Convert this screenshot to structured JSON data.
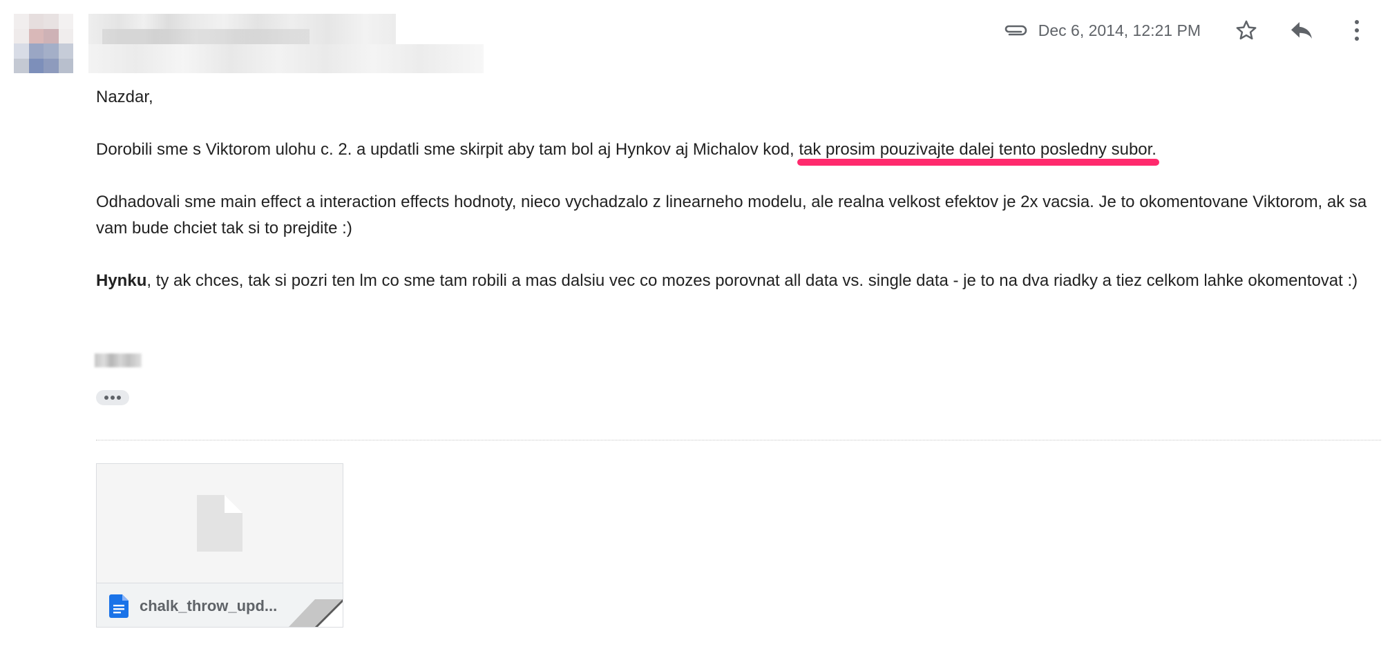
{
  "header": {
    "date": "Dec 6, 2014, 12:21 PM",
    "icons": [
      "attachment-icon",
      "star-icon",
      "reply-icon",
      "more-vert-icon"
    ]
  },
  "body": {
    "greeting": "Nazdar,",
    "p1_plain": "Dorobili sme s Viktorom ulohu c. 2. a updatli sme skirpit aby tam bol aj Hynkov aj Michalov kod, ",
    "p1_highlight": "tak prosim pouzivajte dalej tento posledny subor.",
    "p2": "Odhadovali sme main effect a interaction effects hodnoty, nieco vychadzalo z linearneho modelu, ale realna velkost efektov je 2x vacsia. Je to okomentovane Viktorom, ak sa vam bude chciet tak si to prejdite :)",
    "p3_bold": "Hynku",
    "p3_rest": ", ty ak chces, tak si pozri ten lm co sme tam robili a mas dalsiu vec co mozes porovnat all data vs. single data - je to na dva riadky a tiez celkom lahke okomentovat :)"
  },
  "attachment": {
    "name": "chalk_throw_upd..."
  },
  "colors": {
    "highlight_underline": "#ff2a6d",
    "doc_icon_blue": "#1a73e8"
  }
}
